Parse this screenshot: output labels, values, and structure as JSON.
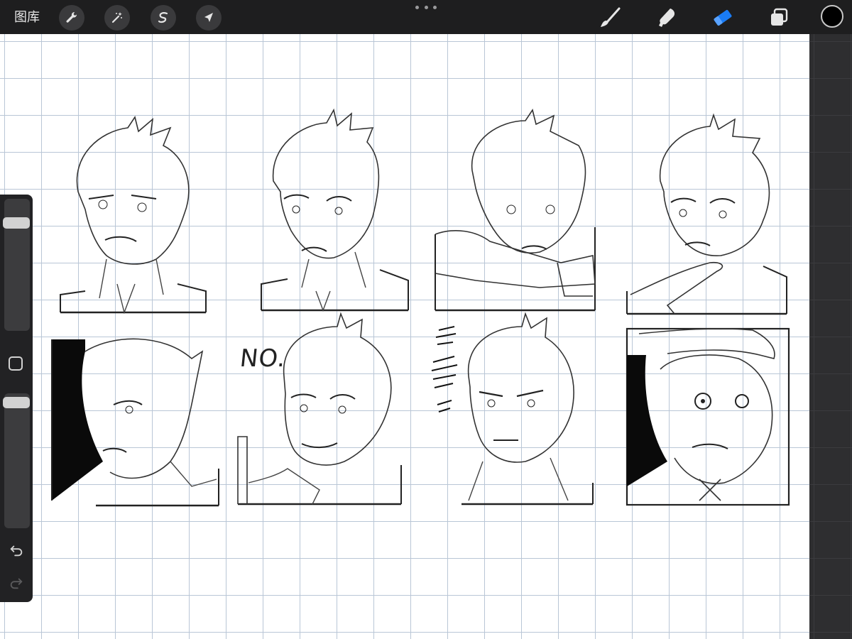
{
  "toolbar": {
    "gallery_label": "图库",
    "left_tools": [
      "wrench-icon",
      "magic-wand-icon",
      "selection-icon",
      "transform-arrow-icon"
    ],
    "right_tools": [
      "brush-icon",
      "smudge-icon",
      "eraser-icon",
      "layers-icon"
    ],
    "active_tool": "eraser-icon",
    "accent_color": "#1a7cf5",
    "current_color": "#000000"
  },
  "canvas": {
    "annotation_text": "NO."
  },
  "sidebar": {
    "brush_size_level": 0.85,
    "opacity_level": 0.97
  }
}
